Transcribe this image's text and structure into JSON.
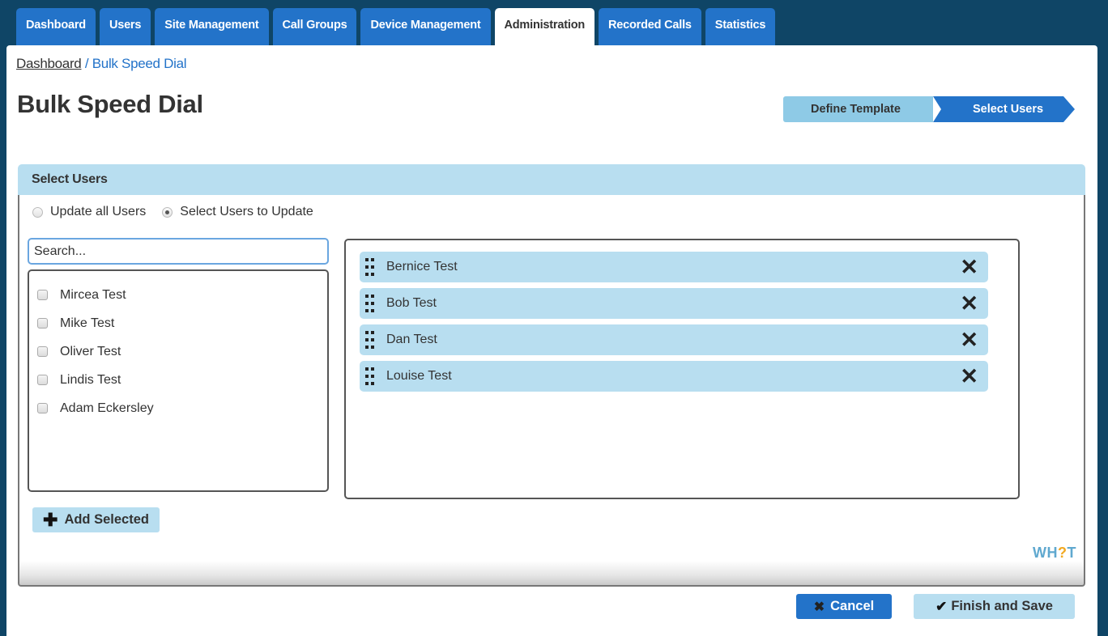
{
  "nav": {
    "tabs": [
      {
        "label": "Dashboard",
        "active": false
      },
      {
        "label": "Users",
        "active": false
      },
      {
        "label": "Site Management",
        "active": false
      },
      {
        "label": "Call Groups",
        "active": false
      },
      {
        "label": "Device Management",
        "active": false
      },
      {
        "label": "Administration",
        "active": true
      },
      {
        "label": "Recorded Calls",
        "active": false
      },
      {
        "label": "Statistics",
        "active": false
      }
    ]
  },
  "breadcrumb": {
    "home": "Dashboard",
    "separator": " / ",
    "current": "Bulk Speed Dial"
  },
  "page": {
    "title": "Bulk Speed Dial"
  },
  "wizard": {
    "steps": [
      {
        "label": "Define Template",
        "active": false
      },
      {
        "label": "Select Users",
        "active": true
      }
    ]
  },
  "panel": {
    "title": "Select Users",
    "radio_options": [
      {
        "label": "Update all Users",
        "checked": false
      },
      {
        "label": "Select Users to Update",
        "checked": true
      }
    ],
    "search": {
      "placeholder": "Search...",
      "value": ""
    },
    "available_users": [
      {
        "name": "Mircea Test",
        "checked": false
      },
      {
        "name": "Mike Test",
        "checked": false
      },
      {
        "name": "Oliver Test",
        "checked": false
      },
      {
        "name": "Lindis Test",
        "checked": false
      },
      {
        "name": "Adam Eckersley",
        "checked": false
      }
    ],
    "selected_users": [
      {
        "name": "Bernice Test"
      },
      {
        "name": "Bob Test"
      },
      {
        "name": "Dan Test"
      },
      {
        "name": "Louise Test"
      }
    ],
    "add_selected_label": "Add Selected",
    "logo": {
      "prefix": "WH",
      "mark": "?",
      "suffix": "T"
    }
  },
  "actions": {
    "cancel_label": "Cancel",
    "save_label": "Finish and Save"
  },
  "icons": {
    "remove": "✕",
    "plus": "✚",
    "check": "✔",
    "cancel": "✖"
  },
  "colors": {
    "primary": "#2373c9",
    "light": "#b8def0",
    "background": "#0f4566",
    "logo": "#5fa8cf",
    "logo_accent": "#f2a922"
  }
}
